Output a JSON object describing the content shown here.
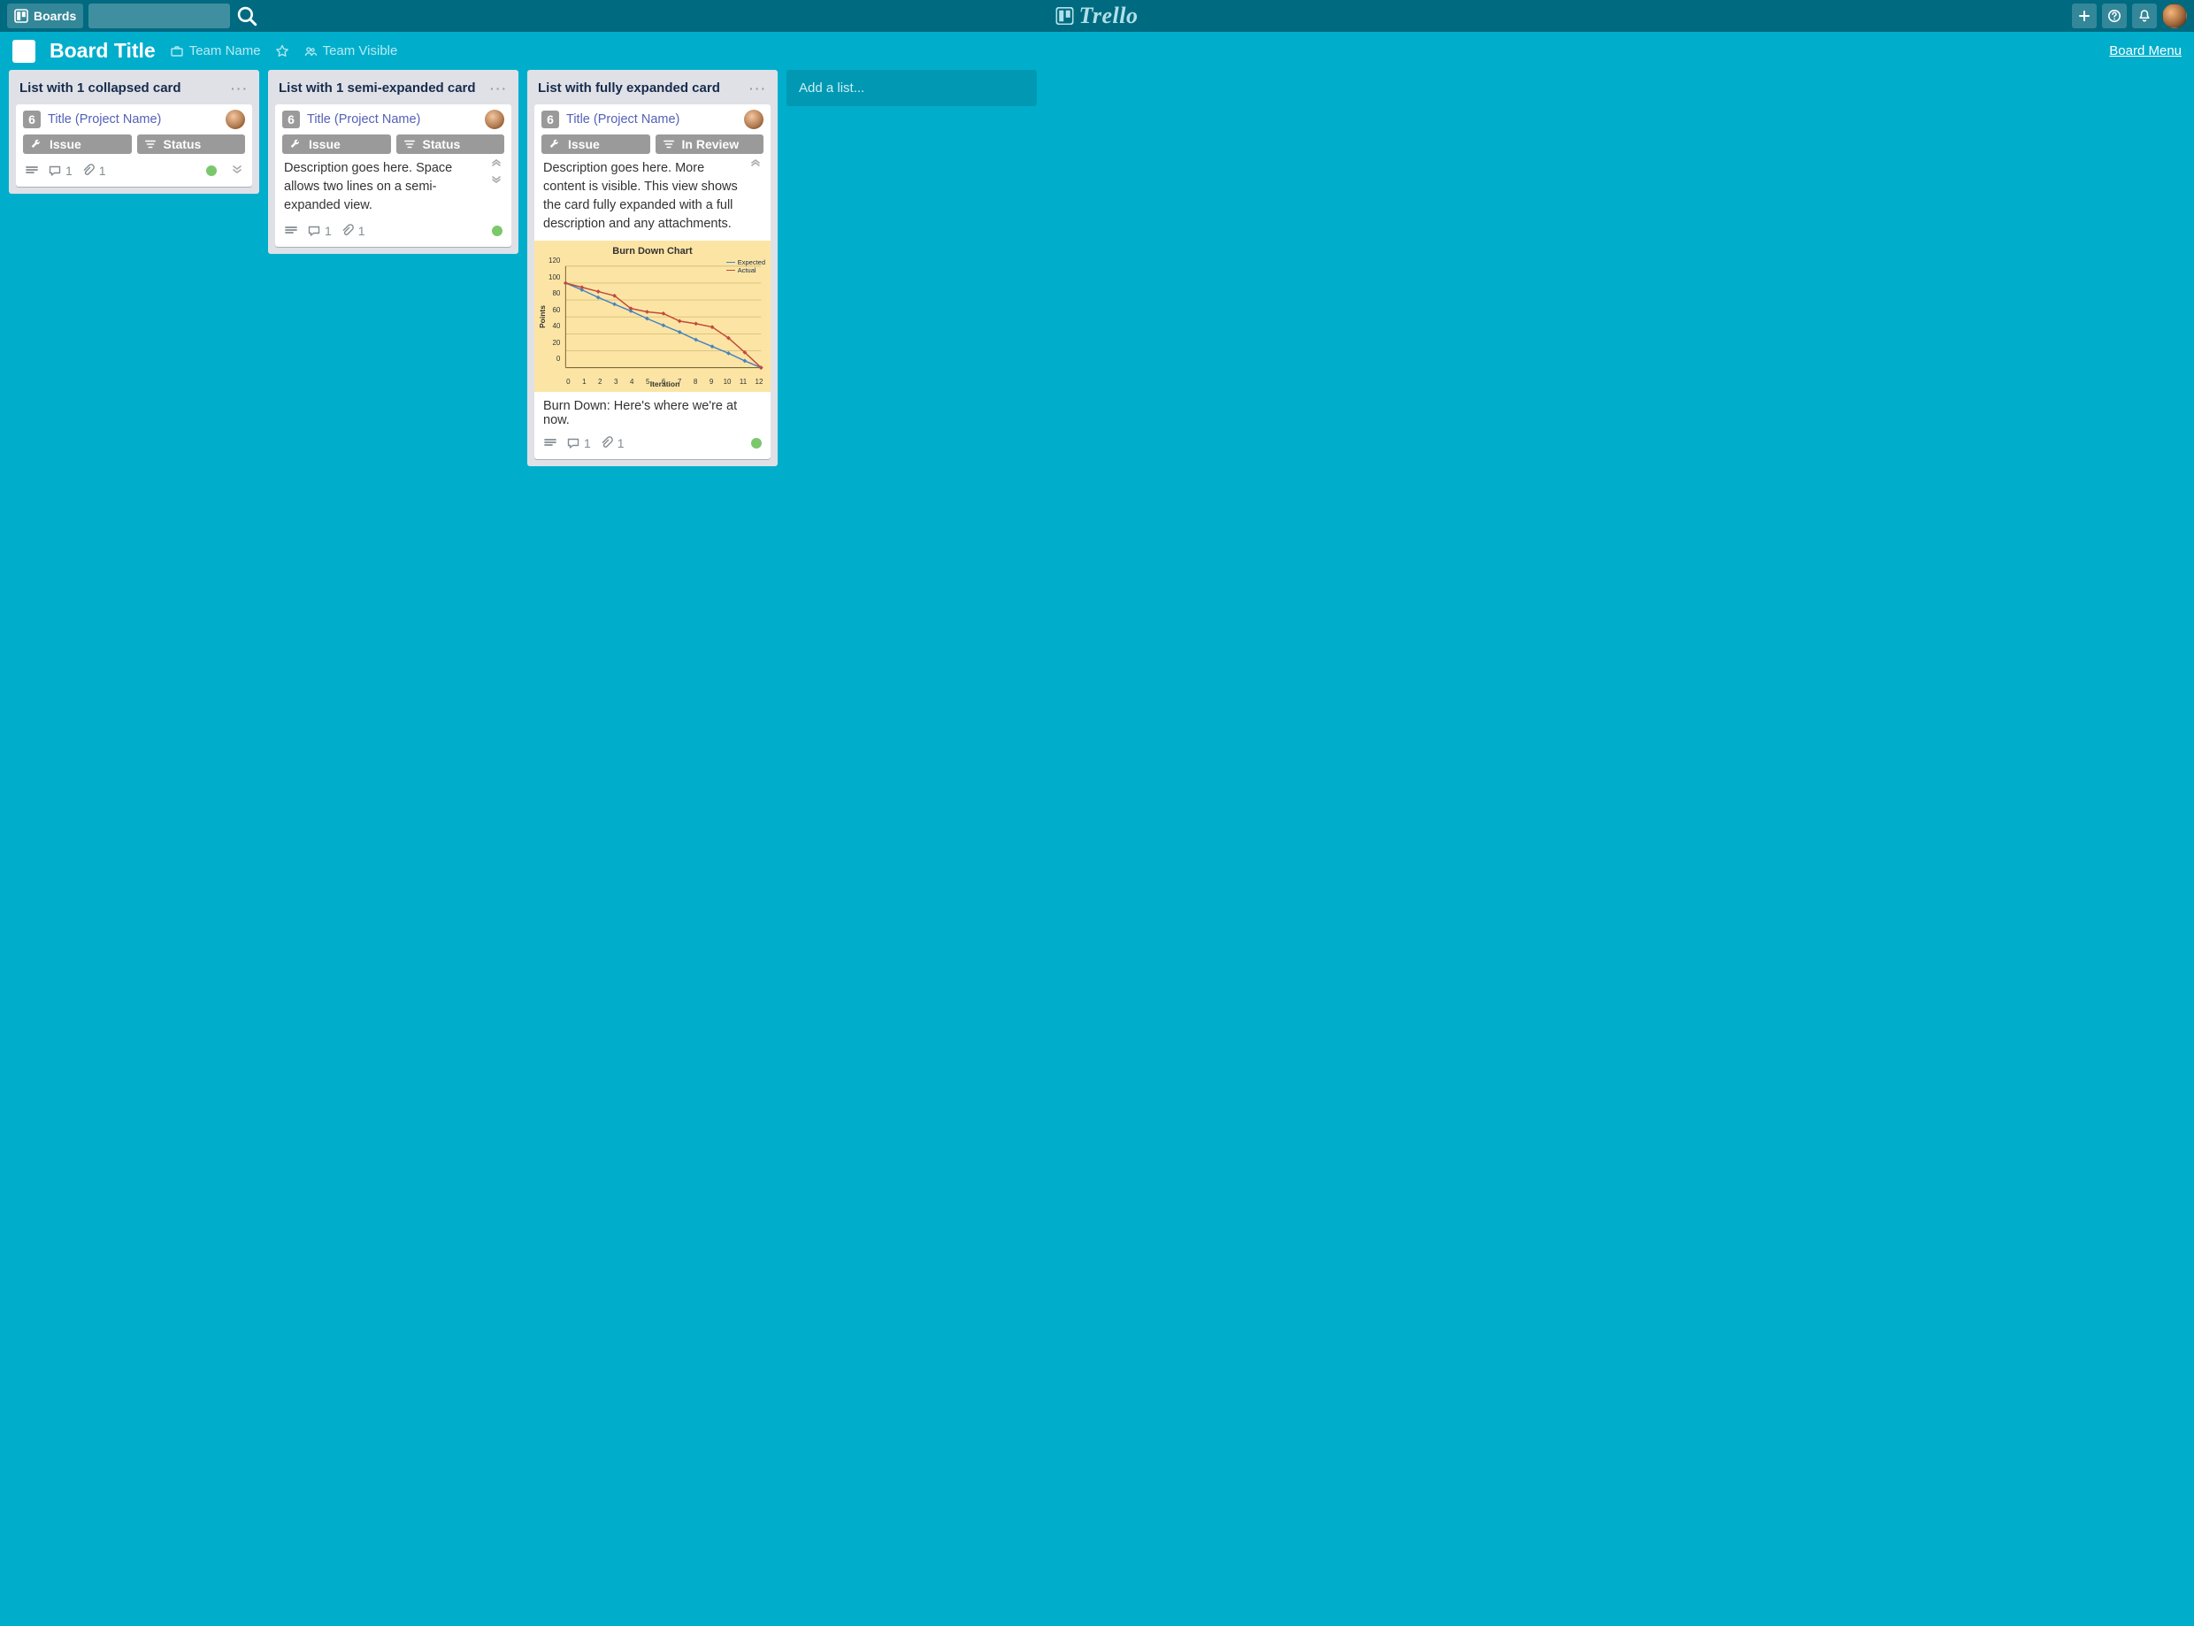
{
  "nav": {
    "boards_label": "Boards",
    "search_placeholder": ""
  },
  "logo": {
    "text": "Trello"
  },
  "header": {
    "board_title": "Board Title",
    "team_name": "Team Name",
    "visibility": "Team Visible",
    "menu_label": "Board Menu"
  },
  "lists": [
    {
      "title": "List with 1 collapsed card",
      "card": {
        "number": "6",
        "title": "Title (Project Name)",
        "pills": [
          {
            "icon": "wrench-icon",
            "label": "Issue"
          },
          {
            "icon": "filter-icon",
            "label": "Status"
          }
        ],
        "comments": "1",
        "attachments": "1",
        "status_color": "#7bc86c"
      }
    },
    {
      "title": "List with 1 semi-expanded card",
      "card": {
        "number": "6",
        "title": "Title (Project Name)",
        "pills": [
          {
            "icon": "wrench-icon",
            "label": "Issue"
          },
          {
            "icon": "filter-icon",
            "label": "Status"
          }
        ],
        "description": "Description goes here. Space allows two lines on a semi-expanded view.",
        "comments": "1",
        "attachments": "1",
        "status_color": "#7bc86c"
      }
    },
    {
      "title": "List with fully expanded card",
      "card": {
        "number": "6",
        "title": "Title (Project Name)",
        "pills": [
          {
            "icon": "wrench-icon",
            "label": "Issue"
          },
          {
            "icon": "filter-icon",
            "label": "In Review"
          }
        ],
        "description": "Description goes here. More content is visible. This view shows the card fully expanded with a full description and any attachments.",
        "caption": "Burn Down: Here's where we're at now.",
        "comments": "1",
        "attachments": "1",
        "status_color": "#7bc86c"
      }
    }
  ],
  "add_list_label": "Add a list...",
  "chart_data": {
    "type": "line",
    "title": "Burn Down Chart",
    "xlabel": "Iteration",
    "ylabel": "Points",
    "x": [
      0,
      1,
      2,
      3,
      4,
      5,
      6,
      7,
      8,
      9,
      10,
      11,
      12
    ],
    "series": [
      {
        "name": "Expected",
        "color": "#4784c3",
        "values": [
          100,
          92,
          83,
          75,
          67,
          58,
          50,
          42,
          33,
          25,
          17,
          8,
          0
        ]
      },
      {
        "name": "Actual",
        "color": "#c24a3b",
        "values": [
          100,
          95,
          90,
          85,
          70,
          66,
          64,
          55,
          52,
          48,
          35,
          18,
          0
        ]
      }
    ],
    "ylim": [
      0,
      120
    ],
    "yticks": [
      0,
      20,
      40,
      60,
      80,
      100,
      120
    ],
    "legend_labels": {
      "expected": "Expected",
      "actual": "Actual"
    }
  }
}
